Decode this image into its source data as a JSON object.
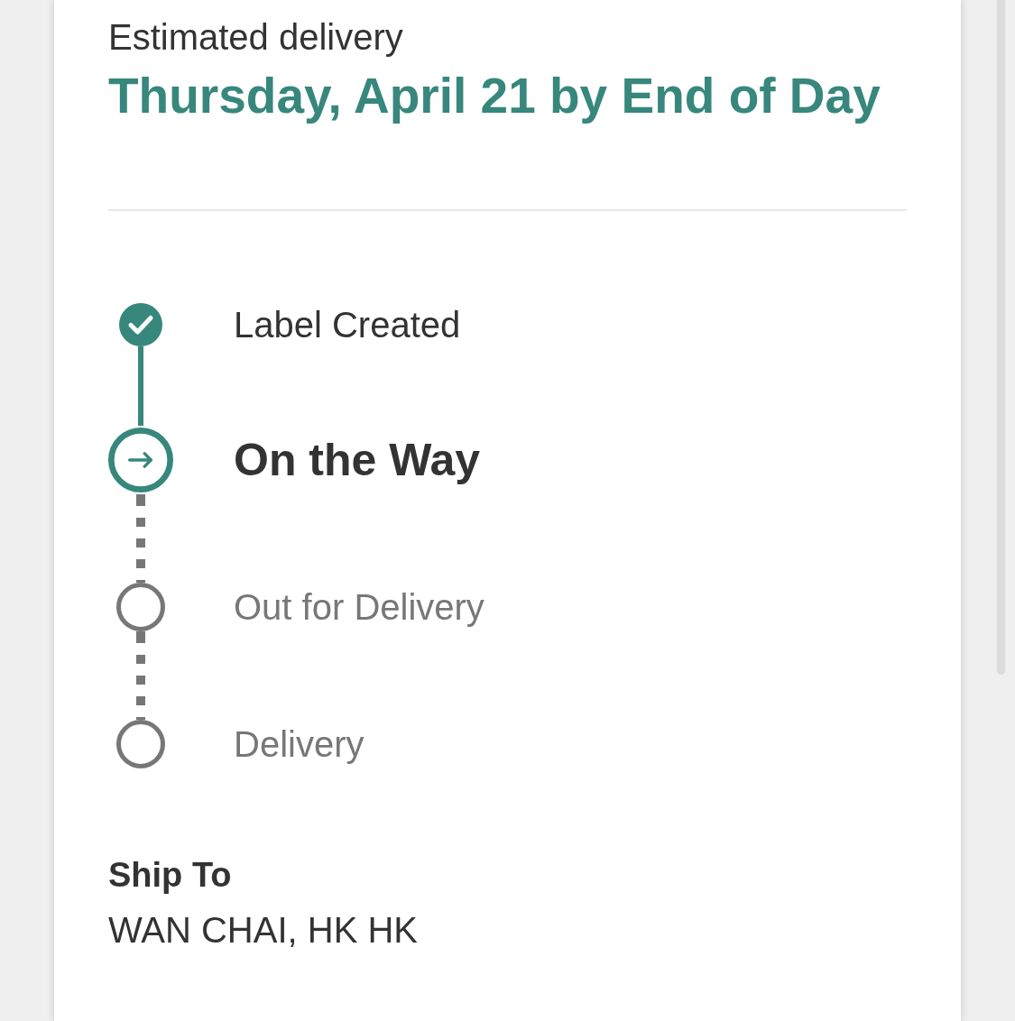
{
  "estimated_delivery": {
    "label": "Estimated delivery",
    "date": "Thursday, April 21 by End of Day"
  },
  "steps": [
    {
      "label": "Label Created",
      "completed": true,
      "current": false
    },
    {
      "label": "On the Way",
      "completed": false,
      "current": true
    },
    {
      "label": "Out for Delivery",
      "completed": false,
      "current": false
    },
    {
      "label": "Delivery",
      "completed": false,
      "current": false
    }
  ],
  "ship_to": {
    "label": "Ship To",
    "address": "WAN CHAI, HK HK"
  }
}
